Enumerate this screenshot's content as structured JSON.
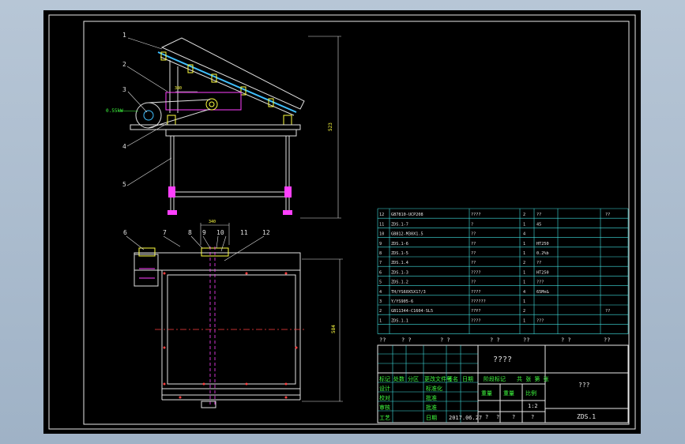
{
  "drawing": {
    "callouts": [
      "1",
      "2",
      "3",
      "4",
      "5",
      "6",
      "7",
      "8",
      "9",
      "10",
      "11",
      "12"
    ],
    "dim_height": "523",
    "dim_width": "584",
    "dim_small_top": "380",
    "dim_small_plan": "340",
    "motor_label": "0.55kW"
  },
  "bom": {
    "rows": [
      {
        "no": "12",
        "code": "GB7810-UCP208",
        "name": "????",
        "qty": "2",
        "mat": "??",
        "note": "??"
      },
      {
        "no": "11",
        "code": "ZDS.1-7",
        "name": "?",
        "qty": "1",
        "mat": "45",
        "note": ""
      },
      {
        "no": "10",
        "code": "GB812-M30X1.5",
        "name": "??",
        "qty": "4",
        "mat": "",
        "note": ""
      },
      {
        "no": "9",
        "code": "ZDS.1-6",
        "name": "??",
        "qty": "1",
        "mat": "HT250",
        "note": ""
      },
      {
        "no": "8",
        "code": "ZDS.1-5",
        "name": "??",
        "qty": "1",
        "mat": "0.2%b",
        "note": ""
      },
      {
        "no": "7",
        "code": "ZDS.1.4",
        "name": "??",
        "qty": "2",
        "mat": "??",
        "note": ""
      },
      {
        "no": "6",
        "code": "ZDS.1-3",
        "name": "????",
        "qty": "1",
        "mat": "HT250",
        "note": ""
      },
      {
        "no": "5",
        "code": "ZDS.1.2",
        "name": "??",
        "qty": "1",
        "mat": "???",
        "note": ""
      },
      {
        "no": "4",
        "code": "TH/YS60X5X17/3",
        "name": "????",
        "qty": "4",
        "mat": "65Mn&",
        "note": ""
      },
      {
        "no": "3",
        "code": "Y/YS905-6",
        "name": "??????",
        "qty": "1",
        "mat": "",
        "note": ""
      },
      {
        "no": "2",
        "code": "GB11344-C1604-SL5",
        "name": "??Y?",
        "qty": "2",
        "mat": "",
        "note": "??"
      },
      {
        "no": "1",
        "code": "ZDS.1.1",
        "name": "????",
        "qty": "1",
        "mat": "???",
        "note": ""
      }
    ],
    "header": [
      "??",
      "? ?",
      "? ?",
      "? ?",
      "??",
      "? ?",
      "??"
    ]
  },
  "title_block": {
    "drawing_title": "????",
    "company": "???",
    "drawing_no": "ZDS.1",
    "date": "2017.06.27",
    "scale": "1:2",
    "row_labels": [
      "标记",
      "处数",
      "分区",
      "更改文件号",
      "签名",
      "日期"
    ],
    "label_design": "设计",
    "label_check": "校对",
    "label_review": "审核",
    "label_process": "工艺",
    "label_std": "标准化",
    "label_approve": "批准",
    "label_stage": "阶段标记",
    "label_weight": "重量",
    "label_ratio": "比例",
    "label_sheet": "共 张 第 张",
    "label_date": "日期",
    "q": "?"
  }
}
